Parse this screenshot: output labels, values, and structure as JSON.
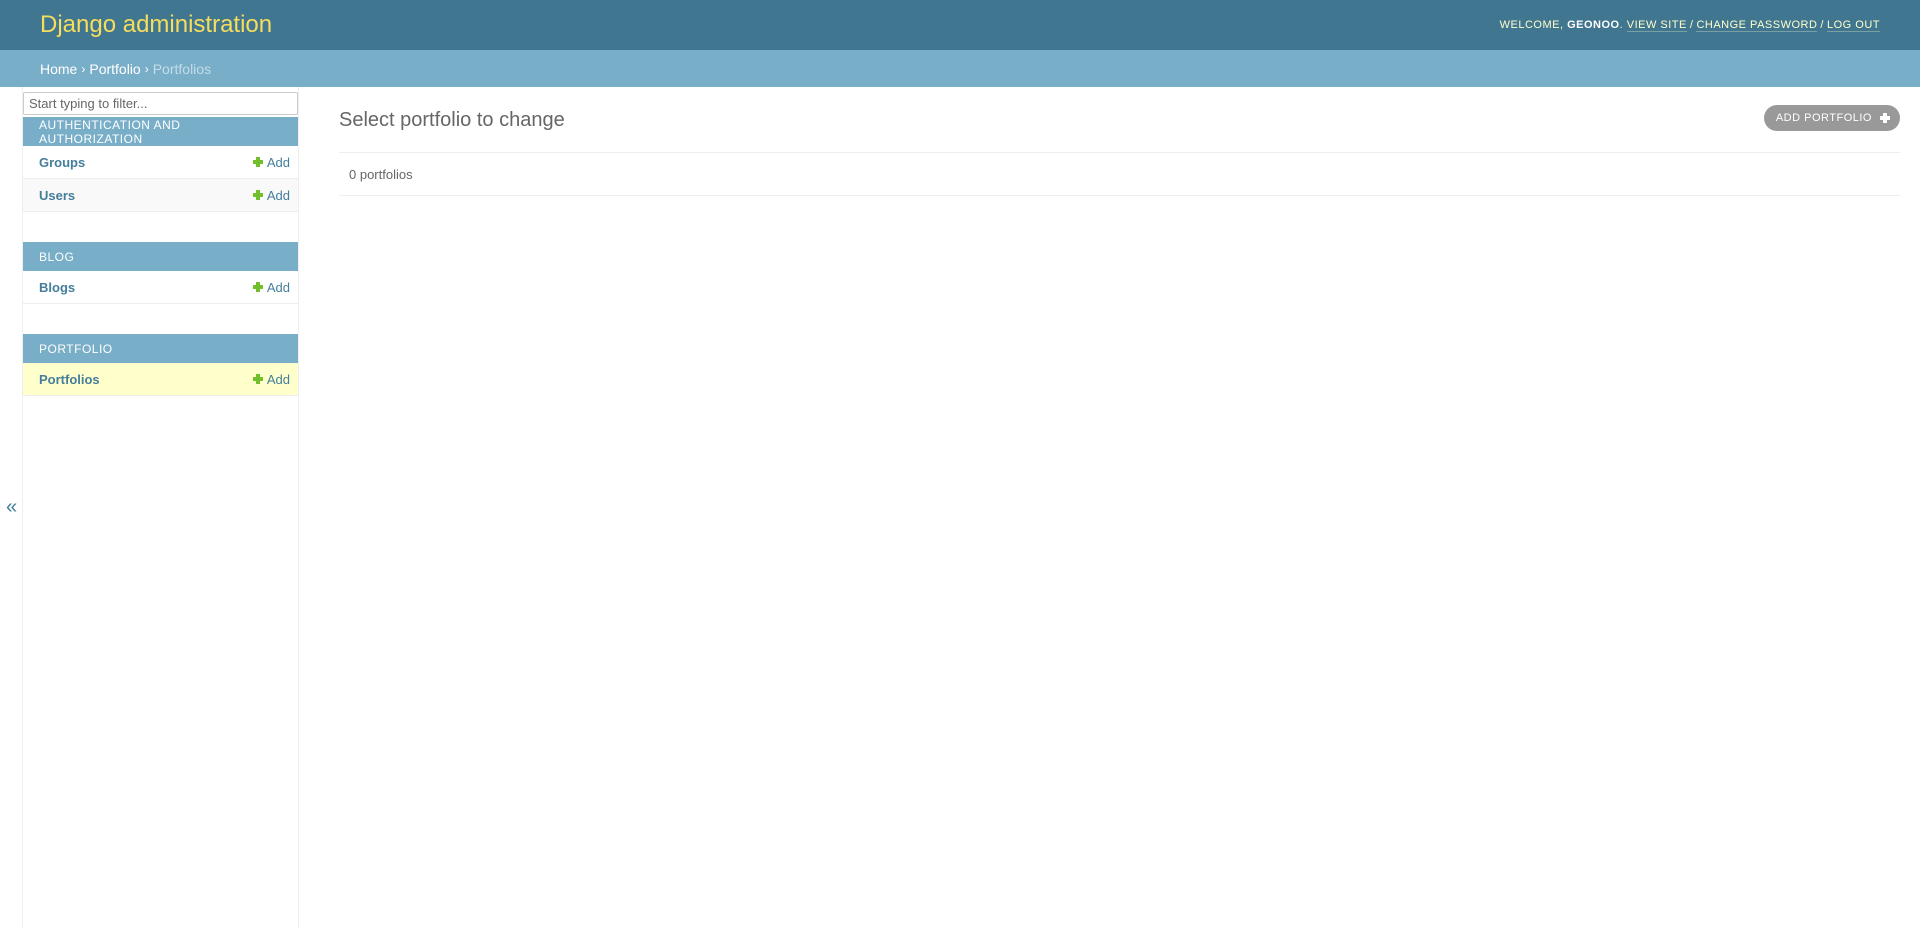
{
  "header": {
    "site_name": "Django administration",
    "welcome": "Welcome,",
    "username": "GEONOO",
    "view_site": "View site",
    "change_password": "Change password",
    "log_out": "Log out"
  },
  "breadcrumbs": {
    "home": "Home",
    "app": "Portfolio",
    "current": "Portfolios"
  },
  "sidebar": {
    "toggle_label": "«",
    "filter_placeholder": "Start typing to filter...",
    "modules": [
      {
        "caption": "Authentication and Authorization",
        "models": [
          {
            "name": "Groups",
            "add_label": "Add"
          },
          {
            "name": "Users",
            "add_label": "Add"
          }
        ]
      },
      {
        "caption": "Blog",
        "models": [
          {
            "name": "Blogs",
            "add_label": "Add"
          }
        ]
      },
      {
        "caption": "Portfolio",
        "models": [
          {
            "name": "Portfolios",
            "add_label": "Add"
          }
        ]
      }
    ]
  },
  "content": {
    "title": "Select portfolio to change",
    "add_button": "Add portfolio",
    "paginator": "0 portfolios"
  },
  "colors": {
    "header_bg": "#417690",
    "breadcrumbs_bg": "#79aec8",
    "site_name": "#f5dd5d",
    "link": "#447e9b",
    "add_icon": "#70bf2b",
    "current_row": "#ffffcc"
  }
}
